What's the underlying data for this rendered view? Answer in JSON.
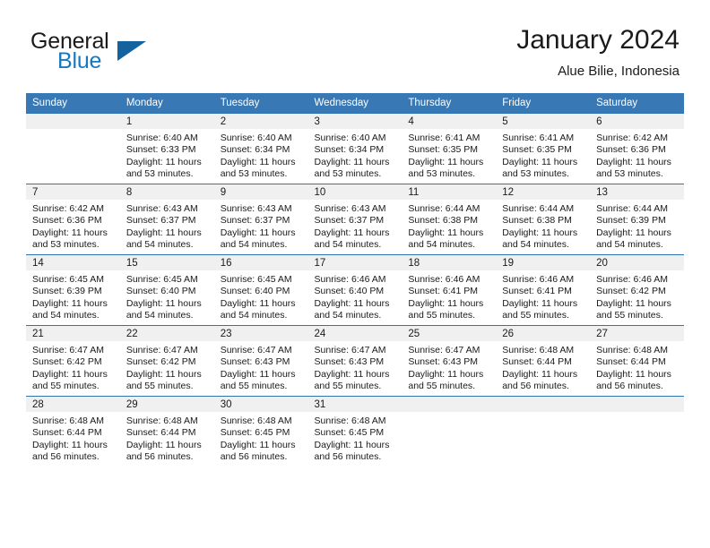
{
  "brand": {
    "word1": "General",
    "word2": "Blue",
    "triangle_color": "#14639f",
    "blue_color": "#1878be"
  },
  "header": {
    "title": "January 2024",
    "subtitle": "Alue Bilie, Indonesia"
  },
  "theme": {
    "header_row_bg": "#3878b4",
    "row_separator": "#2f73b3",
    "date_band_bg": "#f0f0f0",
    "text": "#1a1a1a"
  },
  "weekdays": [
    "Sunday",
    "Monday",
    "Tuesday",
    "Wednesday",
    "Thursday",
    "Friday",
    "Saturday"
  ],
  "weeks": [
    [
      {
        "day": "",
        "sunrise": "",
        "sunset": "",
        "daylight1": "",
        "daylight2": ""
      },
      {
        "day": "1",
        "sunrise": "Sunrise: 6:40 AM",
        "sunset": "Sunset: 6:33 PM",
        "daylight1": "Daylight: 11 hours",
        "daylight2": "and 53 minutes."
      },
      {
        "day": "2",
        "sunrise": "Sunrise: 6:40 AM",
        "sunset": "Sunset: 6:34 PM",
        "daylight1": "Daylight: 11 hours",
        "daylight2": "and 53 minutes."
      },
      {
        "day": "3",
        "sunrise": "Sunrise: 6:40 AM",
        "sunset": "Sunset: 6:34 PM",
        "daylight1": "Daylight: 11 hours",
        "daylight2": "and 53 minutes."
      },
      {
        "day": "4",
        "sunrise": "Sunrise: 6:41 AM",
        "sunset": "Sunset: 6:35 PM",
        "daylight1": "Daylight: 11 hours",
        "daylight2": "and 53 minutes."
      },
      {
        "day": "5",
        "sunrise": "Sunrise: 6:41 AM",
        "sunset": "Sunset: 6:35 PM",
        "daylight1": "Daylight: 11 hours",
        "daylight2": "and 53 minutes."
      },
      {
        "day": "6",
        "sunrise": "Sunrise: 6:42 AM",
        "sunset": "Sunset: 6:36 PM",
        "daylight1": "Daylight: 11 hours",
        "daylight2": "and 53 minutes."
      }
    ],
    [
      {
        "day": "7",
        "sunrise": "Sunrise: 6:42 AM",
        "sunset": "Sunset: 6:36 PM",
        "daylight1": "Daylight: 11 hours",
        "daylight2": "and 53 minutes."
      },
      {
        "day": "8",
        "sunrise": "Sunrise: 6:43 AM",
        "sunset": "Sunset: 6:37 PM",
        "daylight1": "Daylight: 11 hours",
        "daylight2": "and 54 minutes."
      },
      {
        "day": "9",
        "sunrise": "Sunrise: 6:43 AM",
        "sunset": "Sunset: 6:37 PM",
        "daylight1": "Daylight: 11 hours",
        "daylight2": "and 54 minutes."
      },
      {
        "day": "10",
        "sunrise": "Sunrise: 6:43 AM",
        "sunset": "Sunset: 6:37 PM",
        "daylight1": "Daylight: 11 hours",
        "daylight2": "and 54 minutes."
      },
      {
        "day": "11",
        "sunrise": "Sunrise: 6:44 AM",
        "sunset": "Sunset: 6:38 PM",
        "daylight1": "Daylight: 11 hours",
        "daylight2": "and 54 minutes."
      },
      {
        "day": "12",
        "sunrise": "Sunrise: 6:44 AM",
        "sunset": "Sunset: 6:38 PM",
        "daylight1": "Daylight: 11 hours",
        "daylight2": "and 54 minutes."
      },
      {
        "day": "13",
        "sunrise": "Sunrise: 6:44 AM",
        "sunset": "Sunset: 6:39 PM",
        "daylight1": "Daylight: 11 hours",
        "daylight2": "and 54 minutes."
      }
    ],
    [
      {
        "day": "14",
        "sunrise": "Sunrise: 6:45 AM",
        "sunset": "Sunset: 6:39 PM",
        "daylight1": "Daylight: 11 hours",
        "daylight2": "and 54 minutes."
      },
      {
        "day": "15",
        "sunrise": "Sunrise: 6:45 AM",
        "sunset": "Sunset: 6:40 PM",
        "daylight1": "Daylight: 11 hours",
        "daylight2": "and 54 minutes."
      },
      {
        "day": "16",
        "sunrise": "Sunrise: 6:45 AM",
        "sunset": "Sunset: 6:40 PM",
        "daylight1": "Daylight: 11 hours",
        "daylight2": "and 54 minutes."
      },
      {
        "day": "17",
        "sunrise": "Sunrise: 6:46 AM",
        "sunset": "Sunset: 6:40 PM",
        "daylight1": "Daylight: 11 hours",
        "daylight2": "and 54 minutes."
      },
      {
        "day": "18",
        "sunrise": "Sunrise: 6:46 AM",
        "sunset": "Sunset: 6:41 PM",
        "daylight1": "Daylight: 11 hours",
        "daylight2": "and 55 minutes."
      },
      {
        "day": "19",
        "sunrise": "Sunrise: 6:46 AM",
        "sunset": "Sunset: 6:41 PM",
        "daylight1": "Daylight: 11 hours",
        "daylight2": "and 55 minutes."
      },
      {
        "day": "20",
        "sunrise": "Sunrise: 6:46 AM",
        "sunset": "Sunset: 6:42 PM",
        "daylight1": "Daylight: 11 hours",
        "daylight2": "and 55 minutes."
      }
    ],
    [
      {
        "day": "21",
        "sunrise": "Sunrise: 6:47 AM",
        "sunset": "Sunset: 6:42 PM",
        "daylight1": "Daylight: 11 hours",
        "daylight2": "and 55 minutes."
      },
      {
        "day": "22",
        "sunrise": "Sunrise: 6:47 AM",
        "sunset": "Sunset: 6:42 PM",
        "daylight1": "Daylight: 11 hours",
        "daylight2": "and 55 minutes."
      },
      {
        "day": "23",
        "sunrise": "Sunrise: 6:47 AM",
        "sunset": "Sunset: 6:43 PM",
        "daylight1": "Daylight: 11 hours",
        "daylight2": "and 55 minutes."
      },
      {
        "day": "24",
        "sunrise": "Sunrise: 6:47 AM",
        "sunset": "Sunset: 6:43 PM",
        "daylight1": "Daylight: 11 hours",
        "daylight2": "and 55 minutes."
      },
      {
        "day": "25",
        "sunrise": "Sunrise: 6:47 AM",
        "sunset": "Sunset: 6:43 PM",
        "daylight1": "Daylight: 11 hours",
        "daylight2": "and 55 minutes."
      },
      {
        "day": "26",
        "sunrise": "Sunrise: 6:48 AM",
        "sunset": "Sunset: 6:44 PM",
        "daylight1": "Daylight: 11 hours",
        "daylight2": "and 56 minutes."
      },
      {
        "day": "27",
        "sunrise": "Sunrise: 6:48 AM",
        "sunset": "Sunset: 6:44 PM",
        "daylight1": "Daylight: 11 hours",
        "daylight2": "and 56 minutes."
      }
    ],
    [
      {
        "day": "28",
        "sunrise": "Sunrise: 6:48 AM",
        "sunset": "Sunset: 6:44 PM",
        "daylight1": "Daylight: 11 hours",
        "daylight2": "and 56 minutes."
      },
      {
        "day": "29",
        "sunrise": "Sunrise: 6:48 AM",
        "sunset": "Sunset: 6:44 PM",
        "daylight1": "Daylight: 11 hours",
        "daylight2": "and 56 minutes."
      },
      {
        "day": "30",
        "sunrise": "Sunrise: 6:48 AM",
        "sunset": "Sunset: 6:45 PM",
        "daylight1": "Daylight: 11 hours",
        "daylight2": "and 56 minutes."
      },
      {
        "day": "31",
        "sunrise": "Sunrise: 6:48 AM",
        "sunset": "Sunset: 6:45 PM",
        "daylight1": "Daylight: 11 hours",
        "daylight2": "and 56 minutes."
      },
      {
        "day": "",
        "sunrise": "",
        "sunset": "",
        "daylight1": "",
        "daylight2": ""
      },
      {
        "day": "",
        "sunrise": "",
        "sunset": "",
        "daylight1": "",
        "daylight2": ""
      },
      {
        "day": "",
        "sunrise": "",
        "sunset": "",
        "daylight1": "",
        "daylight2": ""
      }
    ]
  ]
}
